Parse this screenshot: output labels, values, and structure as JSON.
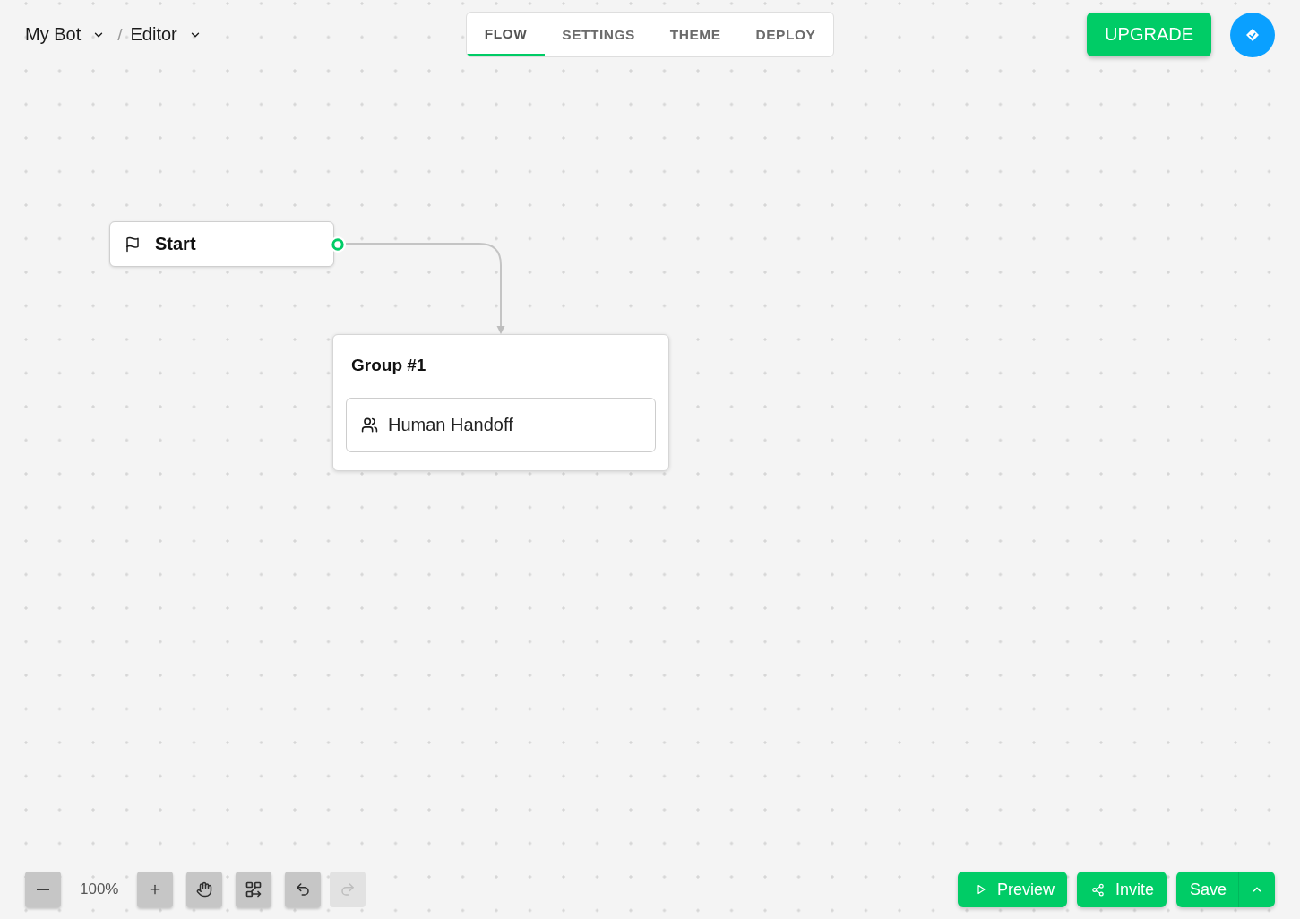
{
  "breadcrumb": {
    "separator": "/",
    "items": [
      {
        "label": "My Bot"
      },
      {
        "label": "Editor"
      }
    ]
  },
  "tabs": [
    {
      "label": "FLOW",
      "selected": true
    },
    {
      "label": "SETTINGS",
      "selected": false
    },
    {
      "label": "THEME",
      "selected": false
    },
    {
      "label": "DEPLOY",
      "selected": false
    }
  ],
  "upgrade_button": {
    "label": "UPGRADE"
  },
  "canvas": {
    "start_node": {
      "label": "Start"
    },
    "groups": [
      {
        "title": "Group #1",
        "blocks": [
          {
            "kind": "human_handoff",
            "label": "Human Handoff"
          }
        ]
      }
    ]
  },
  "zoom": {
    "value": "100%"
  },
  "tools": [
    {
      "kind": "pan",
      "disabled": false
    },
    {
      "kind": "auto_layout",
      "disabled": false
    },
    {
      "kind": "undo",
      "disabled": false
    },
    {
      "kind": "redo",
      "disabled": true
    }
  ],
  "actions": [
    {
      "kind": "preview",
      "label": "Preview"
    },
    {
      "kind": "invite",
      "label": "Invite"
    },
    {
      "kind": "save",
      "label": "Save"
    }
  ]
}
